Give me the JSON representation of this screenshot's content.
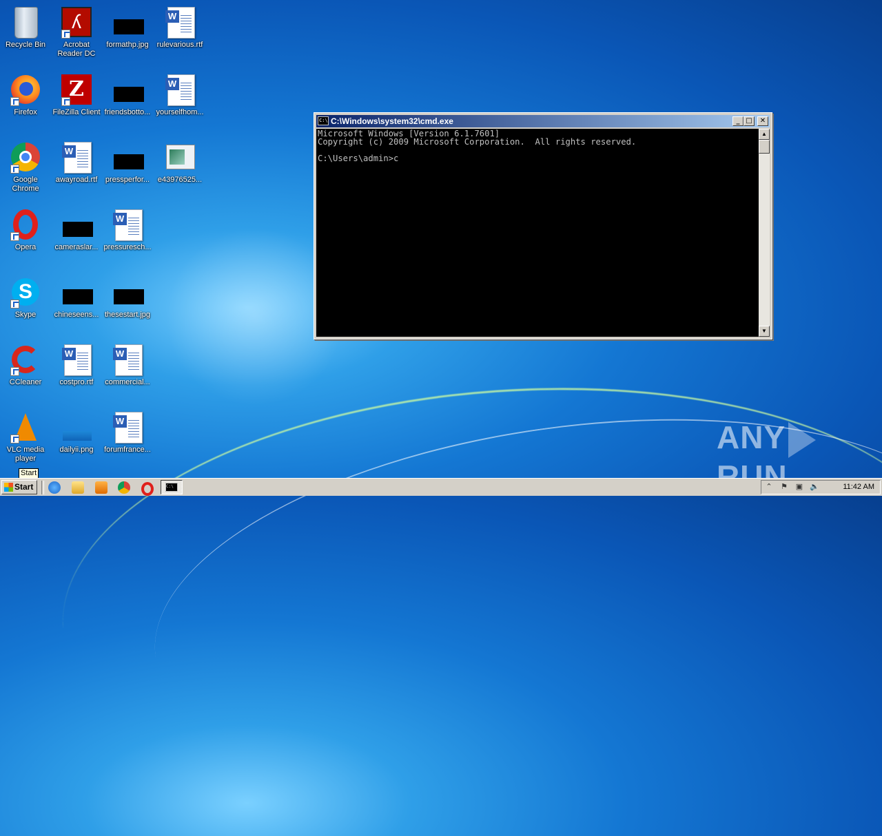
{
  "desktop": {
    "icons": [
      {
        "label": "Recycle Bin",
        "icon": "recycle-bin-icon"
      },
      {
        "label": "Acrobat Reader DC",
        "icon": "acrobat-icon"
      },
      {
        "label": "formathp.jpg",
        "icon": "image-file-icon"
      },
      {
        "label": "rulevarious.rtf",
        "icon": "word-document-icon"
      },
      {
        "label": "Firefox",
        "icon": "firefox-icon"
      },
      {
        "label": "FileZilla Client",
        "icon": "filezilla-icon"
      },
      {
        "label": "friendsbotto...",
        "icon": "image-file-icon"
      },
      {
        "label": "yourselfhom...",
        "icon": "word-document-icon"
      },
      {
        "label": "Google Chrome",
        "icon": "chrome-icon"
      },
      {
        "label": "awayroad.rtf",
        "icon": "word-document-icon"
      },
      {
        "label": "pressperfor...",
        "icon": "image-file-icon"
      },
      {
        "label": "e43976525...",
        "icon": "image-file-icon"
      },
      {
        "label": "Opera",
        "icon": "opera-icon"
      },
      {
        "label": "cameraslar...",
        "icon": "image-file-icon"
      },
      {
        "label": "pressuresch...",
        "icon": "word-document-icon"
      },
      {
        "label": "Skype",
        "icon": "skype-icon"
      },
      {
        "label": "chineseens...",
        "icon": "image-file-icon"
      },
      {
        "label": "thesestart.jpg",
        "icon": "image-file-icon"
      },
      {
        "label": "CCleaner",
        "icon": "ccleaner-icon"
      },
      {
        "label": "costpro.rtf",
        "icon": "word-document-icon"
      },
      {
        "label": "commercial...",
        "icon": "word-document-icon"
      },
      {
        "label": "VLC media player",
        "icon": "vlc-icon"
      },
      {
        "label": "dailyii.png",
        "icon": "image-file-icon"
      },
      {
        "label": "forumfrance...",
        "icon": "word-document-icon"
      }
    ]
  },
  "cmd": {
    "title": "C:\\Windows\\system32\\cmd.exe",
    "icon_text": "C:\\",
    "lines": [
      "Microsoft Windows [Version 6.1.7601]",
      "Copyright (c) 2009 Microsoft Corporation.  All rights reserved.",
      "",
      "C:\\Users\\admin>c"
    ],
    "minimize_glyph": "_",
    "maximize_glyph": "□",
    "close_glyph": "✕",
    "scroll_up_glyph": "▲",
    "scroll_down_glyph": "▼"
  },
  "tooltip": {
    "text": "Start"
  },
  "taskbar": {
    "start_label": "Start",
    "task_icon_text": "C:\\",
    "clock": "11:42 AM",
    "tray_glyphs": [
      "⌃",
      "⚑",
      "▣",
      "🔈"
    ]
  },
  "watermark": {
    "left": "ANY",
    "right": "RUN"
  }
}
